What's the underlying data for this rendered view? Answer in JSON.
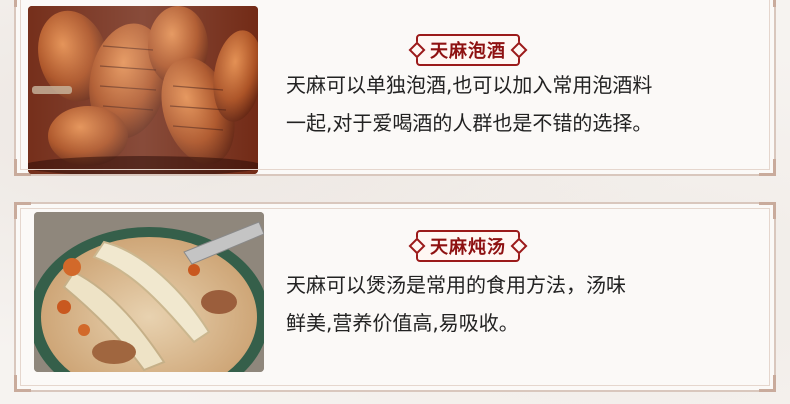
{
  "sections": [
    {
      "badge": "天麻泡酒",
      "line1": "天麻可以单独泡酒,也可以加入常用泡酒料",
      "line2": "一起,对于爱喝酒的人群也是不错的选择。",
      "image_icon": "wine-jar-tianma-photo"
    },
    {
      "badge": "天麻炖汤",
      "line1": "天麻可以煲汤是常用的食用方法，汤味",
      "line2": "鲜美,营养价值高,易吸收。",
      "image_icon": "tianma-soup-bowl-photo"
    }
  ],
  "colors": {
    "accent": "#8e1111",
    "border": "#d9c7bd",
    "background": "#f6f3f0"
  }
}
